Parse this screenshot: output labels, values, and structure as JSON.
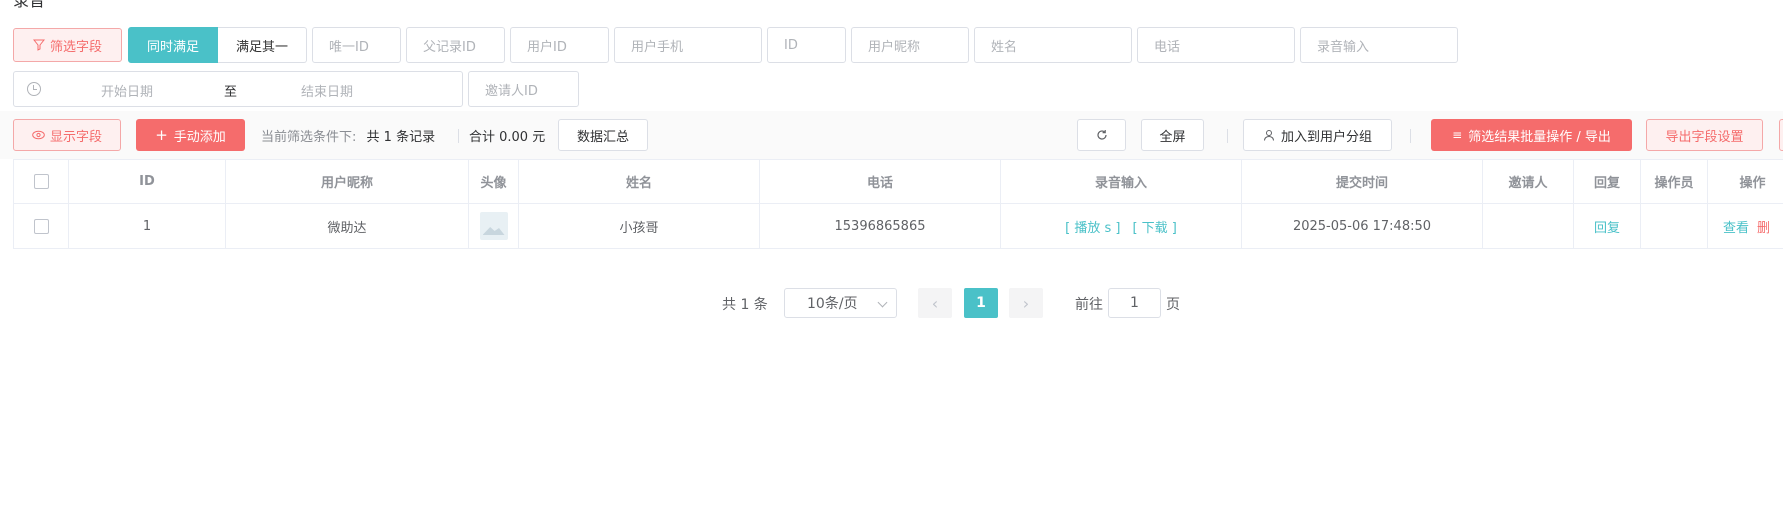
{
  "page": {
    "title": "录音"
  },
  "filters": {
    "filter_button": "筛选字段",
    "match_all": "同时满足",
    "match_any": "满足其一",
    "fields": [
      "唯一ID",
      "父记录ID",
      "用户ID",
      "用户手机",
      "ID",
      "用户昵称",
      "姓名",
      "电话",
      "录音输入"
    ],
    "date_start": "开始日期",
    "date_sep": "至",
    "date_end": "结束日期",
    "inviter_id": "邀请人ID"
  },
  "toolbar": {
    "show_fields": "显示字段",
    "manual_add": "手动添加",
    "current_filter": "当前筛选条件下:",
    "record_count": "共 1 条记录",
    "total": "合计 0.00 元",
    "summary": "数据汇总",
    "fullscreen": "全屏",
    "add_to_group": "加入到用户分组",
    "batch_export": "筛选结果批量操作 / 导出",
    "export_settings": "导出字段设置"
  },
  "table": {
    "headers": [
      "ID",
      "用户昵称",
      "头像",
      "姓名",
      "电话",
      "录音输入",
      "提交时间",
      "邀请人",
      "回复",
      "操作员",
      "操作"
    ],
    "rows": [
      {
        "id": "1",
        "nickname": "微助达",
        "name": "小孩哥",
        "phone": "15396865865",
        "play": "[ 播放 s ]",
        "download": "[ 下载 ]",
        "submit_time": "2025-05-06 17:48:50",
        "inviter": "",
        "reply": "回复",
        "operator": "",
        "view": "查看",
        "delete": "删"
      }
    ]
  },
  "pagination": {
    "total": "共 1 条",
    "page_size": "10条/页",
    "current_page": "1",
    "goto_label": "前往",
    "goto_value": "1",
    "page_suffix": "页"
  },
  "colors": {
    "accent": "#4ac1c8",
    "danger": "#f56c6c"
  }
}
